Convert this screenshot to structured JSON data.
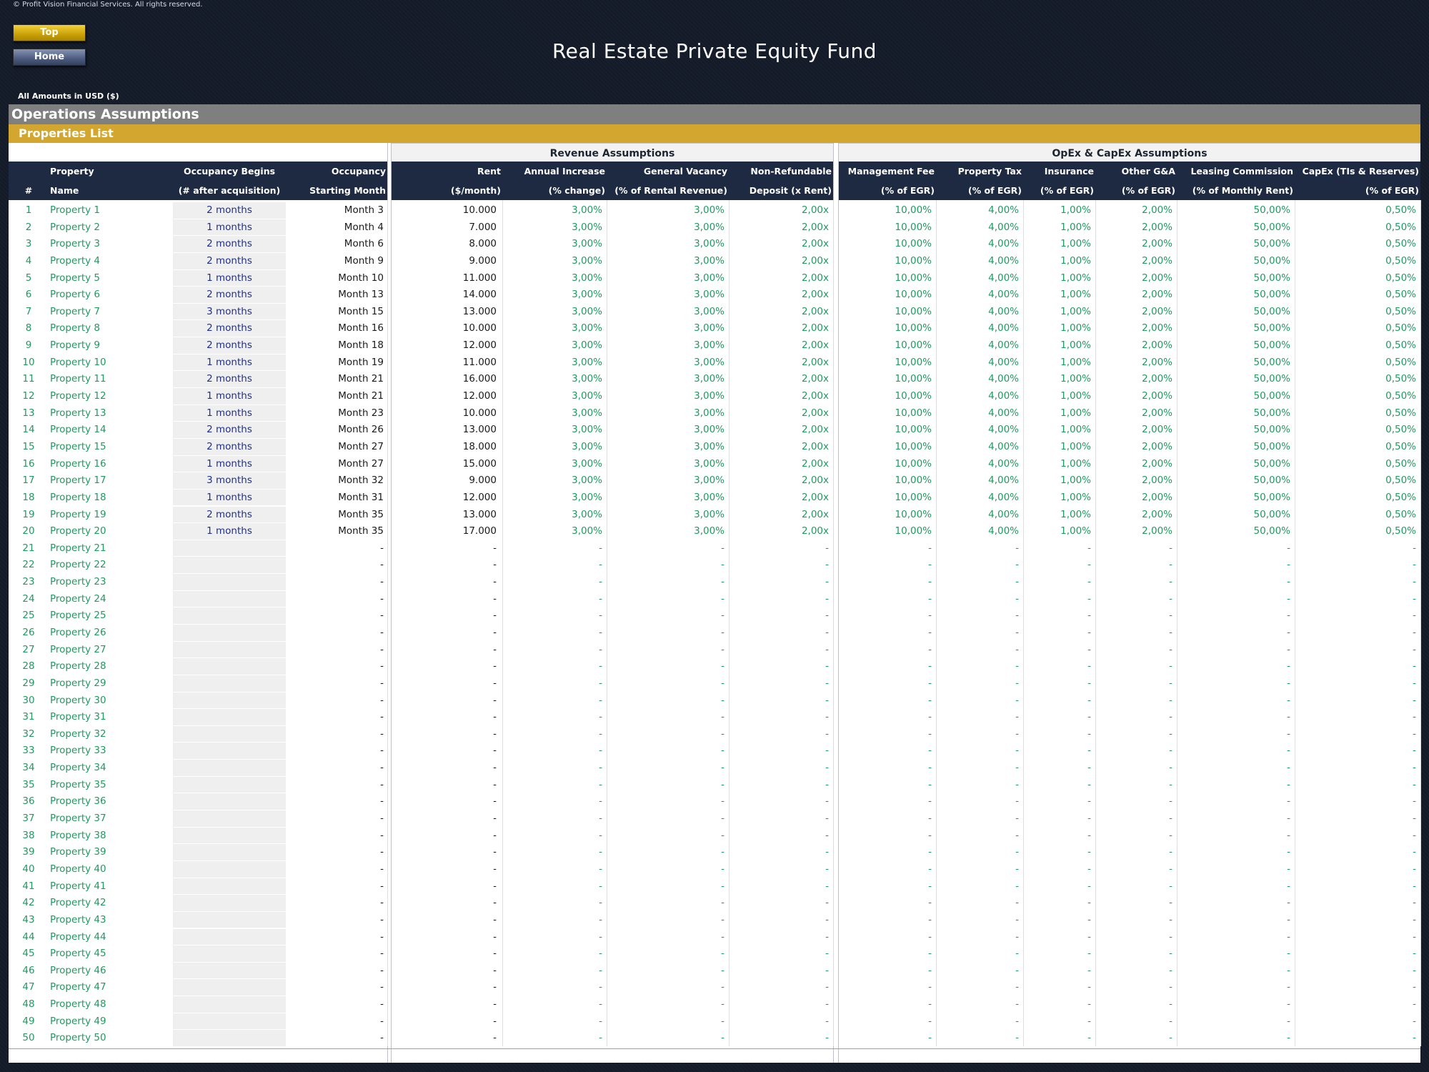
{
  "copyright": "© Profit Vision Financial Services. All rights reserved.",
  "nav": {
    "top_label": "Top",
    "home_label": "Home"
  },
  "title": "Real Estate Private Equity Fund",
  "amounts_label": "All Amounts in  USD ($)",
  "section_title": "Operations Assumptions",
  "subsection_title": "Properties List",
  "groups": {
    "revenue": "Revenue Assumptions",
    "opex": "OpEx & CapEx Assumptions"
  },
  "headers": {
    "num": [
      "",
      "#"
    ],
    "property": [
      "Property",
      "Name"
    ],
    "occ_begins": [
      "Occupancy Begins",
      "(# after acquisition)"
    ],
    "occ_month": [
      "Occupancy",
      "Starting Month"
    ],
    "rent": [
      "Rent",
      "($/month)"
    ],
    "annual_increase": [
      "Annual Increase",
      "(% change)"
    ],
    "vacancy": [
      "General Vacancy",
      "(% of Rental Revenue)"
    ],
    "deposit": [
      "Non-Refundable",
      "Deposit (x Rent)"
    ],
    "mgmt_fee": [
      "Management Fee",
      "(% of EGR)"
    ],
    "prop_tax": [
      "Property Tax",
      "(% of EGR)"
    ],
    "insurance": [
      "Insurance",
      "(% of EGR)"
    ],
    "other_ga": [
      "Other G&A",
      "(% of EGR)"
    ],
    "leasing": [
      "Leasing Commission",
      "(% of Monthly Rent)"
    ],
    "capex": [
      "CapEx (TIs & Reserves)",
      "(% of EGR)"
    ]
  },
  "rows": [
    {
      "num": "1",
      "name": "Property 1",
      "occ": "2 months",
      "month": "Month 3",
      "rent": "10.000",
      "inc": "3,00%",
      "vac": "3,00%",
      "dep": "2,00x",
      "mgmt": "10,00%",
      "tax": "4,00%",
      "ins": "1,00%",
      "ga": "2,00%",
      "lease": "50,00%",
      "capex": "0,50%"
    },
    {
      "num": "2",
      "name": "Property 2",
      "occ": "1 months",
      "month": "Month 4",
      "rent": "7.000",
      "inc": "3,00%",
      "vac": "3,00%",
      "dep": "2,00x",
      "mgmt": "10,00%",
      "tax": "4,00%",
      "ins": "1,00%",
      "ga": "2,00%",
      "lease": "50,00%",
      "capex": "0,50%"
    },
    {
      "num": "3",
      "name": "Property 3",
      "occ": "2 months",
      "month": "Month 6",
      "rent": "8.000",
      "inc": "3,00%",
      "vac": "3,00%",
      "dep": "2,00x",
      "mgmt": "10,00%",
      "tax": "4,00%",
      "ins": "1,00%",
      "ga": "2,00%",
      "lease": "50,00%",
      "capex": "0,50%"
    },
    {
      "num": "4",
      "name": "Property 4",
      "occ": "2 months",
      "month": "Month 9",
      "rent": "9.000",
      "inc": "3,00%",
      "vac": "3,00%",
      "dep": "2,00x",
      "mgmt": "10,00%",
      "tax": "4,00%",
      "ins": "1,00%",
      "ga": "2,00%",
      "lease": "50,00%",
      "capex": "0,50%"
    },
    {
      "num": "5",
      "name": "Property 5",
      "occ": "1 months",
      "month": "Month 10",
      "rent": "11.000",
      "inc": "3,00%",
      "vac": "3,00%",
      "dep": "2,00x",
      "mgmt": "10,00%",
      "tax": "4,00%",
      "ins": "1,00%",
      "ga": "2,00%",
      "lease": "50,00%",
      "capex": "0,50%"
    },
    {
      "num": "6",
      "name": "Property 6",
      "occ": "2 months",
      "month": "Month 13",
      "rent": "14.000",
      "inc": "3,00%",
      "vac": "3,00%",
      "dep": "2,00x",
      "mgmt": "10,00%",
      "tax": "4,00%",
      "ins": "1,00%",
      "ga": "2,00%",
      "lease": "50,00%",
      "capex": "0,50%"
    },
    {
      "num": "7",
      "name": "Property 7",
      "occ": "3 months",
      "month": "Month 15",
      "rent": "13.000",
      "inc": "3,00%",
      "vac": "3,00%",
      "dep": "2,00x",
      "mgmt": "10,00%",
      "tax": "4,00%",
      "ins": "1,00%",
      "ga": "2,00%",
      "lease": "50,00%",
      "capex": "0,50%"
    },
    {
      "num": "8",
      "name": "Property 8",
      "occ": "2 months",
      "month": "Month 16",
      "rent": "10.000",
      "inc": "3,00%",
      "vac": "3,00%",
      "dep": "2,00x",
      "mgmt": "10,00%",
      "tax": "4,00%",
      "ins": "1,00%",
      "ga": "2,00%",
      "lease": "50,00%",
      "capex": "0,50%"
    },
    {
      "num": "9",
      "name": "Property 9",
      "occ": "2 months",
      "month": "Month 18",
      "rent": "12.000",
      "inc": "3,00%",
      "vac": "3,00%",
      "dep": "2,00x",
      "mgmt": "10,00%",
      "tax": "4,00%",
      "ins": "1,00%",
      "ga": "2,00%",
      "lease": "50,00%",
      "capex": "0,50%"
    },
    {
      "num": "10",
      "name": "Property 10",
      "occ": "1 months",
      "month": "Month 19",
      "rent": "11.000",
      "inc": "3,00%",
      "vac": "3,00%",
      "dep": "2,00x",
      "mgmt": "10,00%",
      "tax": "4,00%",
      "ins": "1,00%",
      "ga": "2,00%",
      "lease": "50,00%",
      "capex": "0,50%"
    },
    {
      "num": "11",
      "name": "Property 11",
      "occ": "2 months",
      "month": "Month 21",
      "rent": "16.000",
      "inc": "3,00%",
      "vac": "3,00%",
      "dep": "2,00x",
      "mgmt": "10,00%",
      "tax": "4,00%",
      "ins": "1,00%",
      "ga": "2,00%",
      "lease": "50,00%",
      "capex": "0,50%"
    },
    {
      "num": "12",
      "name": "Property 12",
      "occ": "1 months",
      "month": "Month 21",
      "rent": "12.000",
      "inc": "3,00%",
      "vac": "3,00%",
      "dep": "2,00x",
      "mgmt": "10,00%",
      "tax": "4,00%",
      "ins": "1,00%",
      "ga": "2,00%",
      "lease": "50,00%",
      "capex": "0,50%"
    },
    {
      "num": "13",
      "name": "Property 13",
      "occ": "1 months",
      "month": "Month 23",
      "rent": "10.000",
      "inc": "3,00%",
      "vac": "3,00%",
      "dep": "2,00x",
      "mgmt": "10,00%",
      "tax": "4,00%",
      "ins": "1,00%",
      "ga": "2,00%",
      "lease": "50,00%",
      "capex": "0,50%"
    },
    {
      "num": "14",
      "name": "Property 14",
      "occ": "2 months",
      "month": "Month 26",
      "rent": "13.000",
      "inc": "3,00%",
      "vac": "3,00%",
      "dep": "2,00x",
      "mgmt": "10,00%",
      "tax": "4,00%",
      "ins": "1,00%",
      "ga": "2,00%",
      "lease": "50,00%",
      "capex": "0,50%"
    },
    {
      "num": "15",
      "name": "Property 15",
      "occ": "2 months",
      "month": "Month 27",
      "rent": "18.000",
      "inc": "3,00%",
      "vac": "3,00%",
      "dep": "2,00x",
      "mgmt": "10,00%",
      "tax": "4,00%",
      "ins": "1,00%",
      "ga": "2,00%",
      "lease": "50,00%",
      "capex": "0,50%"
    },
    {
      "num": "16",
      "name": "Property 16",
      "occ": "1 months",
      "month": "Month 27",
      "rent": "15.000",
      "inc": "3,00%",
      "vac": "3,00%",
      "dep": "2,00x",
      "mgmt": "10,00%",
      "tax": "4,00%",
      "ins": "1,00%",
      "ga": "2,00%",
      "lease": "50,00%",
      "capex": "0,50%"
    },
    {
      "num": "17",
      "name": "Property 17",
      "occ": "3 months",
      "month": "Month 32",
      "rent": "9.000",
      "inc": "3,00%",
      "vac": "3,00%",
      "dep": "2,00x",
      "mgmt": "10,00%",
      "tax": "4,00%",
      "ins": "1,00%",
      "ga": "2,00%",
      "lease": "50,00%",
      "capex": "0,50%"
    },
    {
      "num": "18",
      "name": "Property 18",
      "occ": "1 months",
      "month": "Month 31",
      "rent": "12.000",
      "inc": "3,00%",
      "vac": "3,00%",
      "dep": "2,00x",
      "mgmt": "10,00%",
      "tax": "4,00%",
      "ins": "1,00%",
      "ga": "2,00%",
      "lease": "50,00%",
      "capex": "0,50%"
    },
    {
      "num": "19",
      "name": "Property 19",
      "occ": "2 months",
      "month": "Month 35",
      "rent": "13.000",
      "inc": "3,00%",
      "vac": "3,00%",
      "dep": "2,00x",
      "mgmt": "10,00%",
      "tax": "4,00%",
      "ins": "1,00%",
      "ga": "2,00%",
      "lease": "50,00%",
      "capex": "0,50%"
    },
    {
      "num": "20",
      "name": "Property 20",
      "occ": "1 months",
      "month": "Month 35",
      "rent": "17.000",
      "inc": "3,00%",
      "vac": "3,00%",
      "dep": "2,00x",
      "mgmt": "10,00%",
      "tax": "4,00%",
      "ins": "1,00%",
      "ga": "2,00%",
      "lease": "50,00%",
      "capex": "0,50%"
    },
    {
      "num": "21",
      "name": "Property 21",
      "occ": "",
      "month": "-",
      "rent": "-",
      "inc": "-",
      "vac": "-",
      "dep": "-",
      "mgmt": "-",
      "tax": "-",
      "ins": "-",
      "ga": "-",
      "lease": "-",
      "capex": "-"
    },
    {
      "num": "22",
      "name": "Property 22",
      "occ": "",
      "month": "-",
      "rent": "-",
      "inc": "-",
      "vac": "-",
      "dep": "-",
      "mgmt": "-",
      "tax": "-",
      "ins": "-",
      "ga": "-",
      "lease": "-",
      "capex": "-"
    },
    {
      "num": "23",
      "name": "Property 23",
      "occ": "",
      "month": "-",
      "rent": "-",
      "inc": "-",
      "vac": "-",
      "dep": "-",
      "mgmt": "-",
      "tax": "-",
      "ins": "-",
      "ga": "-",
      "lease": "-",
      "capex": "-"
    },
    {
      "num": "24",
      "name": "Property 24",
      "occ": "",
      "month": "-",
      "rent": "-",
      "inc": "-",
      "vac": "-",
      "dep": "-",
      "mgmt": "-",
      "tax": "-",
      "ins": "-",
      "ga": "-",
      "lease": "-",
      "capex": "-"
    },
    {
      "num": "25",
      "name": "Property 25",
      "occ": "",
      "month": "-",
      "rent": "-",
      "inc": "-",
      "vac": "-",
      "dep": "-",
      "mgmt": "-",
      "tax": "-",
      "ins": "-",
      "ga": "-",
      "lease": "-",
      "capex": "-"
    },
    {
      "num": "26",
      "name": "Property 26",
      "occ": "",
      "month": "-",
      "rent": "-",
      "inc": "-",
      "vac": "-",
      "dep": "-",
      "mgmt": "-",
      "tax": "-",
      "ins": "-",
      "ga": "-",
      "lease": "-",
      "capex": "-"
    },
    {
      "num": "27",
      "name": "Property 27",
      "occ": "",
      "month": "-",
      "rent": "-",
      "inc": "-",
      "vac": "-",
      "dep": "-",
      "mgmt": "-",
      "tax": "-",
      "ins": "-",
      "ga": "-",
      "lease": "-",
      "capex": "-"
    },
    {
      "num": "28",
      "name": "Property 28",
      "occ": "",
      "month": "-",
      "rent": "-",
      "inc": "-",
      "vac": "-",
      "dep": "-",
      "mgmt": "-",
      "tax": "-",
      "ins": "-",
      "ga": "-",
      "lease": "-",
      "capex": "-"
    },
    {
      "num": "29",
      "name": "Property 29",
      "occ": "",
      "month": "-",
      "rent": "-",
      "inc": "-",
      "vac": "-",
      "dep": "-",
      "mgmt": "-",
      "tax": "-",
      "ins": "-",
      "ga": "-",
      "lease": "-",
      "capex": "-"
    },
    {
      "num": "30",
      "name": "Property 30",
      "occ": "",
      "month": "-",
      "rent": "-",
      "inc": "-",
      "vac": "-",
      "dep": "-",
      "mgmt": "-",
      "tax": "-",
      "ins": "-",
      "ga": "-",
      "lease": "-",
      "capex": "-"
    },
    {
      "num": "31",
      "name": "Property 31",
      "occ": "",
      "month": "-",
      "rent": "-",
      "inc": "-",
      "vac": "-",
      "dep": "-",
      "mgmt": "-",
      "tax": "-",
      "ins": "-",
      "ga": "-",
      "lease": "-",
      "capex": "-"
    },
    {
      "num": "32",
      "name": "Property 32",
      "occ": "",
      "month": "-",
      "rent": "-",
      "inc": "-",
      "vac": "-",
      "dep": "-",
      "mgmt": "-",
      "tax": "-",
      "ins": "-",
      "ga": "-",
      "lease": "-",
      "capex": "-"
    },
    {
      "num": "33",
      "name": "Property 33",
      "occ": "",
      "month": "-",
      "rent": "-",
      "inc": "-",
      "vac": "-",
      "dep": "-",
      "mgmt": "-",
      "tax": "-",
      "ins": "-",
      "ga": "-",
      "lease": "-",
      "capex": "-"
    },
    {
      "num": "34",
      "name": "Property 34",
      "occ": "",
      "month": "-",
      "rent": "-",
      "inc": "-",
      "vac": "-",
      "dep": "-",
      "mgmt": "-",
      "tax": "-",
      "ins": "-",
      "ga": "-",
      "lease": "-",
      "capex": "-"
    },
    {
      "num": "35",
      "name": "Property 35",
      "occ": "",
      "month": "-",
      "rent": "-",
      "inc": "-",
      "vac": "-",
      "dep": "-",
      "mgmt": "-",
      "tax": "-",
      "ins": "-",
      "ga": "-",
      "lease": "-",
      "capex": "-"
    },
    {
      "num": "36",
      "name": "Property 36",
      "occ": "",
      "month": "-",
      "rent": "-",
      "inc": "-",
      "vac": "-",
      "dep": "-",
      "mgmt": "-",
      "tax": "-",
      "ins": "-",
      "ga": "-",
      "lease": "-",
      "capex": "-"
    },
    {
      "num": "37",
      "name": "Property 37",
      "occ": "",
      "month": "-",
      "rent": "-",
      "inc": "-",
      "vac": "-",
      "dep": "-",
      "mgmt": "-",
      "tax": "-",
      "ins": "-",
      "ga": "-",
      "lease": "-",
      "capex": "-"
    },
    {
      "num": "38",
      "name": "Property 38",
      "occ": "",
      "month": "-",
      "rent": "-",
      "inc": "-",
      "vac": "-",
      "dep": "-",
      "mgmt": "-",
      "tax": "-",
      "ins": "-",
      "ga": "-",
      "lease": "-",
      "capex": "-"
    },
    {
      "num": "39",
      "name": "Property 39",
      "occ": "",
      "month": "-",
      "rent": "-",
      "inc": "-",
      "vac": "-",
      "dep": "-",
      "mgmt": "-",
      "tax": "-",
      "ins": "-",
      "ga": "-",
      "lease": "-",
      "capex": "-"
    },
    {
      "num": "40",
      "name": "Property 40",
      "occ": "",
      "month": "-",
      "rent": "-",
      "inc": "-",
      "vac": "-",
      "dep": "-",
      "mgmt": "-",
      "tax": "-",
      "ins": "-",
      "ga": "-",
      "lease": "-",
      "capex": "-"
    },
    {
      "num": "41",
      "name": "Property 41",
      "occ": "",
      "month": "-",
      "rent": "-",
      "inc": "-",
      "vac": "-",
      "dep": "-",
      "mgmt": "-",
      "tax": "-",
      "ins": "-",
      "ga": "-",
      "lease": "-",
      "capex": "-"
    },
    {
      "num": "42",
      "name": "Property 42",
      "occ": "",
      "month": "-",
      "rent": "-",
      "inc": "-",
      "vac": "-",
      "dep": "-",
      "mgmt": "-",
      "tax": "-",
      "ins": "-",
      "ga": "-",
      "lease": "-",
      "capex": "-"
    },
    {
      "num": "43",
      "name": "Property 43",
      "occ": "",
      "month": "-",
      "rent": "-",
      "inc": "-",
      "vac": "-",
      "dep": "-",
      "mgmt": "-",
      "tax": "-",
      "ins": "-",
      "ga": "-",
      "lease": "-",
      "capex": "-"
    },
    {
      "num": "44",
      "name": "Property 44",
      "occ": "",
      "month": "-",
      "rent": "-",
      "inc": "-",
      "vac": "-",
      "dep": "-",
      "mgmt": "-",
      "tax": "-",
      "ins": "-",
      "ga": "-",
      "lease": "-",
      "capex": "-"
    },
    {
      "num": "45",
      "name": "Property 45",
      "occ": "",
      "month": "-",
      "rent": "-",
      "inc": "-",
      "vac": "-",
      "dep": "-",
      "mgmt": "-",
      "tax": "-",
      "ins": "-",
      "ga": "-",
      "lease": "-",
      "capex": "-"
    },
    {
      "num": "46",
      "name": "Property 46",
      "occ": "",
      "month": "-",
      "rent": "-",
      "inc": "-",
      "vac": "-",
      "dep": "-",
      "mgmt": "-",
      "tax": "-",
      "ins": "-",
      "ga": "-",
      "lease": "-",
      "capex": "-"
    },
    {
      "num": "47",
      "name": "Property 47",
      "occ": "",
      "month": "-",
      "rent": "-",
      "inc": "-",
      "vac": "-",
      "dep": "-",
      "mgmt": "-",
      "tax": "-",
      "ins": "-",
      "ga": "-",
      "lease": "-",
      "capex": "-"
    },
    {
      "num": "48",
      "name": "Property 48",
      "occ": "",
      "month": "-",
      "rent": "-",
      "inc": "-",
      "vac": "-",
      "dep": "-",
      "mgmt": "-",
      "tax": "-",
      "ins": "-",
      "ga": "-",
      "lease": "-",
      "capex": "-"
    },
    {
      "num": "49",
      "name": "Property 49",
      "occ": "",
      "month": "-",
      "rent": "-",
      "inc": "-",
      "vac": "-",
      "dep": "-",
      "mgmt": "-",
      "tax": "-",
      "ins": "-",
      "ga": "-",
      "lease": "-",
      "capex": "-"
    },
    {
      "num": "50",
      "name": "Property 50",
      "occ": "",
      "month": "-",
      "rent": "-",
      "inc": "-",
      "vac": "-",
      "dep": "-",
      "mgmt": "-",
      "tax": "-",
      "ins": "-",
      "ga": "-",
      "lease": "-",
      "capex": "-"
    }
  ]
}
